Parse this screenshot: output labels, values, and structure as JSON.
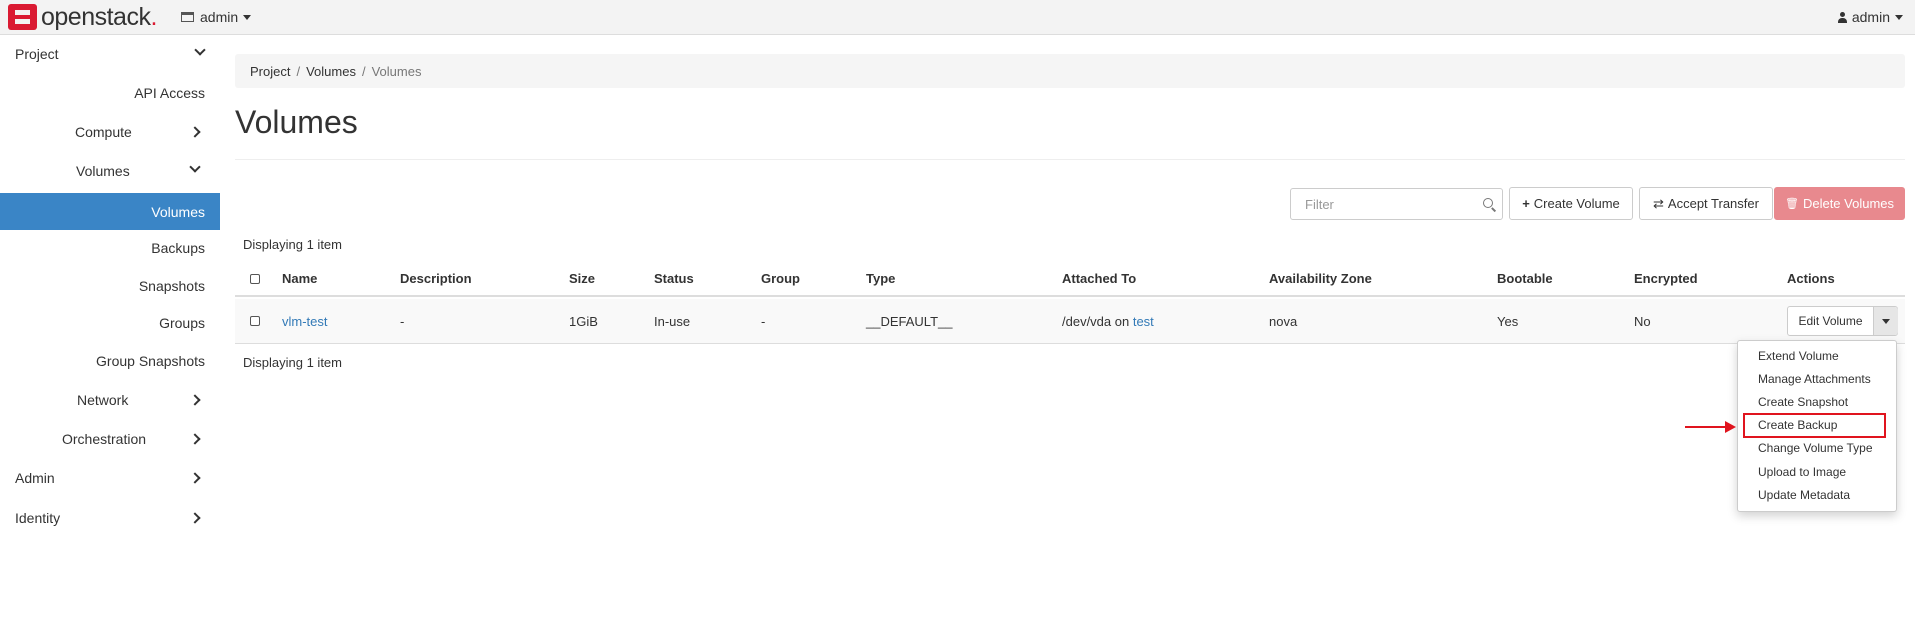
{
  "topbar": {
    "brand": "openstack",
    "brand_dot": ".",
    "project_selector": "admin",
    "user_menu": "admin"
  },
  "sidebar": {
    "project": "Project",
    "api_access": "API Access",
    "compute": "Compute",
    "volumes_group": "Volumes",
    "volumes": "Volumes",
    "backups": "Backups",
    "snapshots": "Snapshots",
    "groups": "Groups",
    "group_snapshots": "Group Snapshots",
    "network": "Network",
    "orchestration": "Orchestration",
    "admin": "Admin",
    "identity": "Identity"
  },
  "breadcrumb": [
    "Project",
    "Volumes",
    "Volumes"
  ],
  "breadcrumb_sep": "/",
  "page_title": "Volumes",
  "toolbar": {
    "filter_placeholder": "Filter",
    "create_volume": "Create Volume",
    "accept_transfer": "Accept Transfer",
    "delete_volumes": "Delete Volumes",
    "plus_glyph": "+",
    "transfer_glyph": "⇄",
    "trash_glyph": "🗑"
  },
  "display_count": "Displaying 1 item",
  "table": {
    "headers": [
      "Name",
      "Description",
      "Size",
      "Status",
      "Group",
      "Type",
      "Attached To",
      "Availability Zone",
      "Bootable",
      "Encrypted",
      "Actions"
    ],
    "row": {
      "name": "vlm-test",
      "description": "-",
      "size": "1GiB",
      "status": "In-use",
      "group": "-",
      "type": "__DEFAULT__",
      "attached_prefix": "/dev/vda on ",
      "attached_link": "test",
      "availability_zone": "nova",
      "bootable": "Yes",
      "encrypted": "No"
    },
    "edit_volume": "Edit Volume"
  },
  "actions_menu": [
    "Extend Volume",
    "Manage Attachments",
    "Create Snapshot",
    "Create Backup",
    "Change Volume Type",
    "Upload to Image",
    "Update Metadata"
  ],
  "highlighted_action": "Create Backup",
  "colors": {
    "brand_red": "#da1a32",
    "active_nav": "#3a85c6",
    "link": "#337ab7",
    "danger_button": "#e8898e",
    "annotation_red": "#e0141e"
  }
}
